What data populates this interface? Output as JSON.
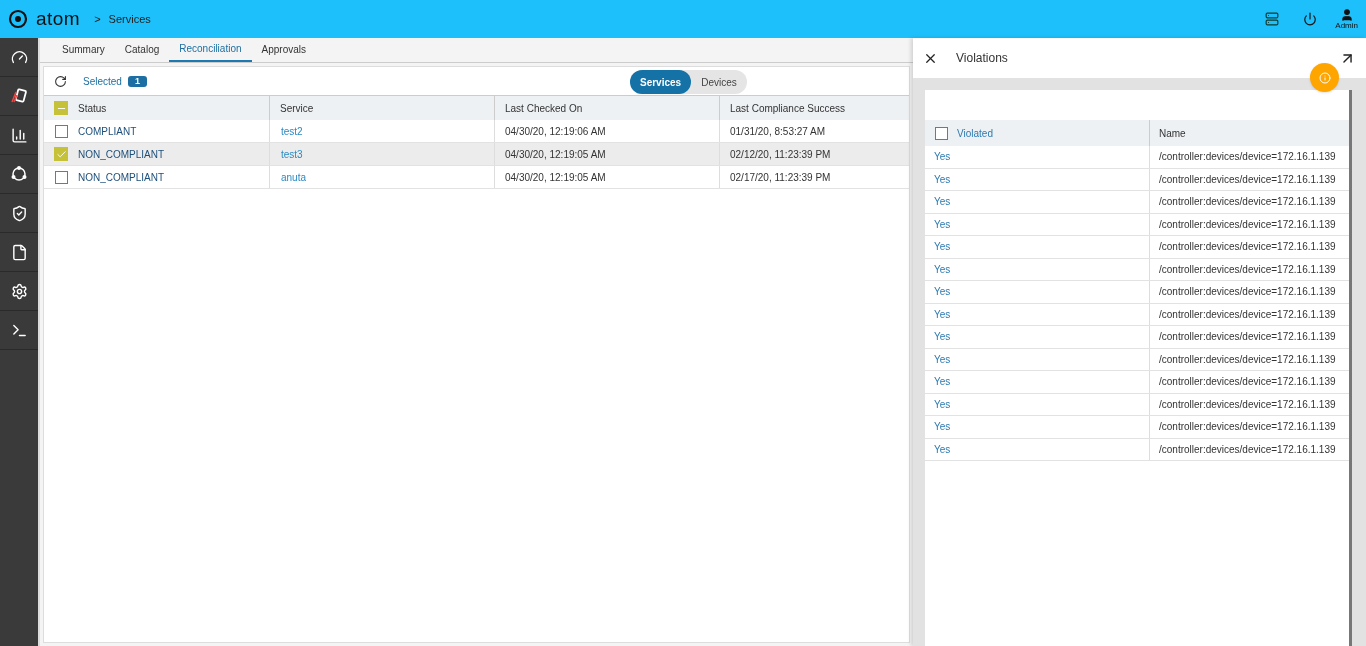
{
  "header": {
    "logo": "atom",
    "breadcrumb_separator": ">",
    "breadcrumb": "Services",
    "user": "Admin"
  },
  "tabs": [
    {
      "label": "Summary",
      "selected": false
    },
    {
      "label": "Catalog",
      "selected": false
    },
    {
      "label": "Reconciliation",
      "selected": true
    },
    {
      "label": "Approvals",
      "selected": false
    }
  ],
  "toolbar": {
    "selected_label": "Selected",
    "selected_count": "1",
    "toggle": [
      {
        "label": "Services",
        "selected": true
      },
      {
        "label": "Devices",
        "selected": false
      }
    ]
  },
  "table": {
    "header_checkbox": {
      "indeterminate": true
    },
    "columns": [
      "Status",
      "Service",
      "Last Checked On",
      "Last Compliance Success"
    ],
    "rows": [
      {
        "checked": false,
        "status": "COMPLIANT",
        "service": "test2",
        "last_checked": "04/30/20, 12:19:06 AM",
        "last_success": "01/31/20, 8:53:27 AM"
      },
      {
        "checked": true,
        "status": "NON_COMPLIANT",
        "service": "test3",
        "last_checked": "04/30/20, 12:19:05 AM",
        "last_success": "02/12/20, 11:23:39 PM"
      },
      {
        "checked": false,
        "status": "NON_COMPLIANT",
        "service": "anuta",
        "last_checked": "04/30/20, 12:19:05 AM",
        "last_success": "02/17/20, 11:23:39 PM"
      }
    ]
  },
  "panel": {
    "title": "Violations",
    "table": {
      "header_checked": false,
      "columns": [
        "Violated",
        "Name"
      ],
      "rows": [
        {
          "violated": "Yes",
          "name": "/controller:devices/device=172.16.1.139"
        },
        {
          "violated": "Yes",
          "name": "/controller:devices/device=172.16.1.139"
        },
        {
          "violated": "Yes",
          "name": "/controller:devices/device=172.16.1.139"
        },
        {
          "violated": "Yes",
          "name": "/controller:devices/device=172.16.1.139"
        },
        {
          "violated": "Yes",
          "name": "/controller:devices/device=172.16.1.139"
        },
        {
          "violated": "Yes",
          "name": "/controller:devices/device=172.16.1.139"
        },
        {
          "violated": "Yes",
          "name": "/controller:devices/device=172.16.1.139"
        },
        {
          "violated": "Yes",
          "name": "/controller:devices/device=172.16.1.139"
        },
        {
          "violated": "Yes",
          "name": "/controller:devices/device=172.16.1.139"
        },
        {
          "violated": "Yes",
          "name": "/controller:devices/device=172.16.1.139"
        },
        {
          "violated": "Yes",
          "name": "/controller:devices/device=172.16.1.139"
        },
        {
          "violated": "Yes",
          "name": "/controller:devices/device=172.16.1.139"
        },
        {
          "violated": "Yes",
          "name": "/controller:devices/device=172.16.1.139"
        },
        {
          "violated": "Yes",
          "name": "/controller:devices/device=172.16.1.139"
        }
      ]
    }
  }
}
